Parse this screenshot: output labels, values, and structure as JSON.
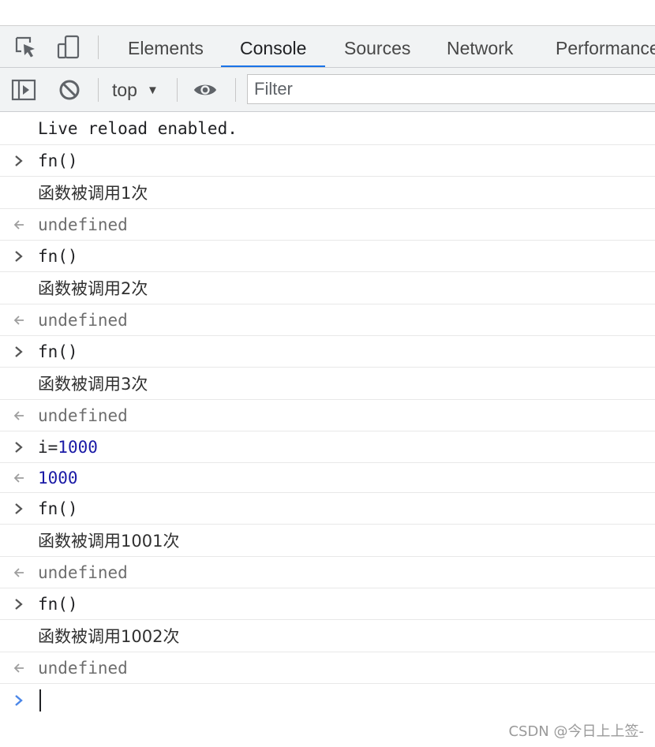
{
  "tabs": [
    {
      "label": "Elements",
      "active": false
    },
    {
      "label": "Console",
      "active": true
    },
    {
      "label": "Sources",
      "active": false
    },
    {
      "label": "Network",
      "active": false
    },
    {
      "label": "Performance",
      "active": false
    }
  ],
  "toolbar": {
    "context": "top",
    "filter_placeholder": "Filter"
  },
  "console": {
    "info": "Live reload enabled.",
    "entries": [
      {
        "input": "fn()",
        "log": "函数被调用1次",
        "result": "undefined"
      },
      {
        "input": "fn()",
        "log": "函数被调用2次",
        "result": "undefined"
      },
      {
        "input": "fn()",
        "log": "函数被调用3次",
        "result": "undefined"
      },
      {
        "input_prefix": "i=",
        "input_value": "1000",
        "result_value": "1000"
      },
      {
        "input": "fn()",
        "log": "函数被调用1001次",
        "result": "undefined"
      },
      {
        "input": "fn()",
        "log": "函数被调用1002次",
        "result": "undefined"
      }
    ]
  },
  "watermark": "CSDN @今日上上签-",
  "colors": {
    "accent": "#1a73e8",
    "number": "#1a1aa6",
    "toolbar_bg": "#f1f3f4",
    "prompt_caret": "#4a86e8"
  }
}
